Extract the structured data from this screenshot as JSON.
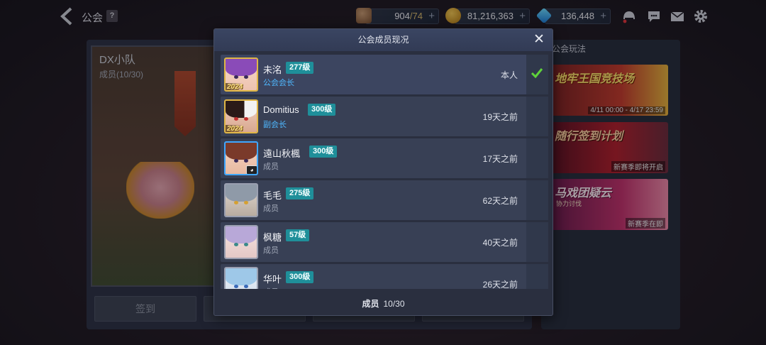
{
  "topbar": {
    "title": "公会",
    "help": "?",
    "stamina": {
      "current": "904",
      "max": "74",
      "sep": "/"
    },
    "gold": "81,216,363",
    "gems": "136,448",
    "plus": "+"
  },
  "background": {
    "team_name": "DX小队",
    "team_members": "成员(10/30)",
    "signin_button": "签到",
    "right_panel_title": "公会玩法",
    "events": [
      {
        "title": "地牢王国竞技场",
        "subtitle": "4/11 00:00 - 4/17 23:59",
        "mini": ""
      },
      {
        "title": "随行签到计划",
        "subtitle": "新赛季即将开启",
        "mini": ""
      },
      {
        "title": "马戏团疑云",
        "subtitle": "新赛季在即",
        "mini": "协力讨伐"
      }
    ]
  },
  "modal": {
    "title": "公会成员现况",
    "close": "✕",
    "footer_label": "成员",
    "footer_count": "10/30",
    "members": [
      {
        "name": "未洺",
        "level": "277级",
        "role": "公会会长",
        "status": "本人",
        "self": true
      },
      {
        "name": "Domitius",
        "level": "300级",
        "role": "副会长",
        "status": "19天之前"
      },
      {
        "name": "遠山秋楓",
        "level": "300级",
        "role": "成员",
        "status": "17天之前"
      },
      {
        "name": "毛毛",
        "level": "275级",
        "role": "成员",
        "status": "62天之前"
      },
      {
        "name": "枫糖",
        "level": "57级",
        "role": "成员",
        "status": "40天之前"
      },
      {
        "name": "华叶",
        "level": "300级",
        "role": "成员",
        "status": "26天之前"
      }
    ],
    "year_badge": "2024"
  },
  "colors": {
    "level_badge": "#1f8f9a",
    "leader_role": "#4fb8ff",
    "check": "#5fd23a",
    "modal_header": "#3a4562"
  }
}
